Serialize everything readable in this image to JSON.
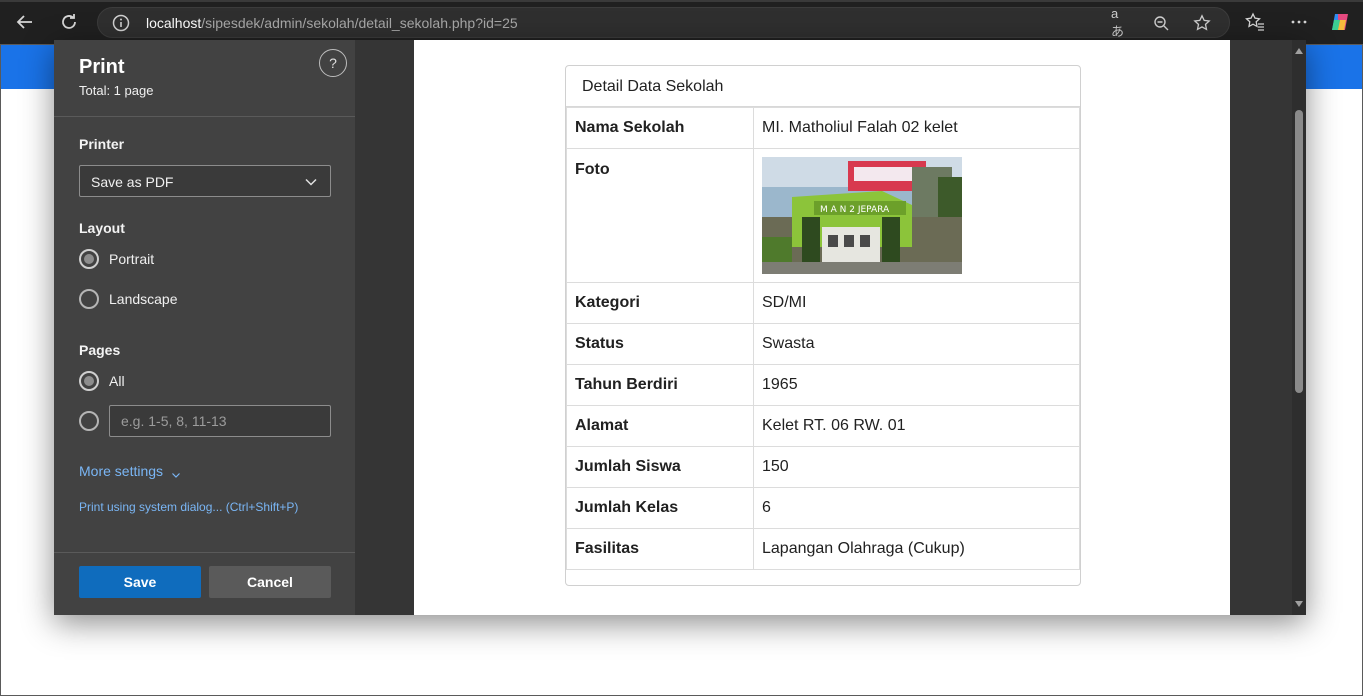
{
  "browser": {
    "url_host": "localhost",
    "url_path": "/sipesdek/admin/sekolah/detail_sekolah.php?id=25"
  },
  "print_panel": {
    "title": "Print",
    "total": "Total: 1 page",
    "help": "?",
    "printer_label": "Printer",
    "printer_value": "Save as PDF",
    "layout_label": "Layout",
    "layout_portrait": "Portrait",
    "layout_landscape": "Landscape",
    "pages_label": "Pages",
    "pages_all": "All",
    "pages_placeholder": "e.g. 1-5, 8, 11-13",
    "more_settings": "More settings",
    "system_dialog": "Print using system dialog... (Ctrl+Shift+P)",
    "save_label": "Save",
    "cancel_label": "Cancel"
  },
  "detail": {
    "header": "Detail Data Sekolah",
    "rows": [
      {
        "key": "Nama Sekolah",
        "value": "MI. Matholiul Falah 02 kelet"
      },
      {
        "key": "Foto",
        "value": ""
      },
      {
        "key": "Kategori",
        "value": "SD/MI"
      },
      {
        "key": "Status",
        "value": "Swasta"
      },
      {
        "key": "Tahun Berdiri",
        "value": "1965"
      },
      {
        "key": "Alamat",
        "value": "Kelet RT. 06 RW. 01"
      },
      {
        "key": "Jumlah Siswa",
        "value": "150"
      },
      {
        "key": "Jumlah Kelas",
        "value": "6"
      },
      {
        "key": "Fasilitas",
        "value": "Lapangan Olahraga (Cukup)"
      }
    ],
    "photo_sign_text": "M A N 2 JEPARA"
  }
}
